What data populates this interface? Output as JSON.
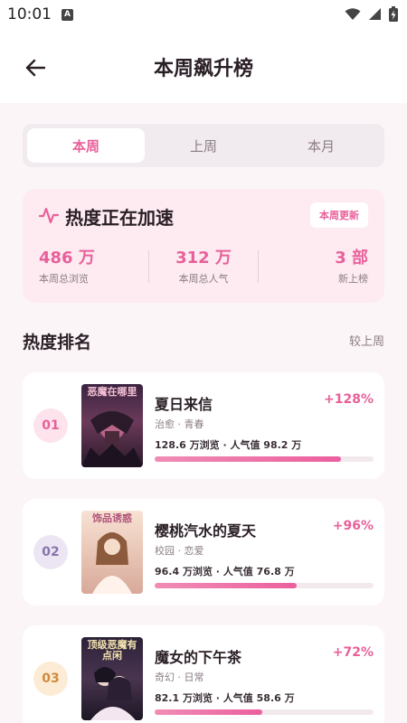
{
  "status_bar": {
    "time": "10:01",
    "notification_icon": "A",
    "icons": [
      "wifi-icon",
      "cellular-signal-icon",
      "battery-charging-icon"
    ]
  },
  "header": {
    "back_icon": "arrow-left-icon",
    "title": "本周飙升榜"
  },
  "tabs": [
    {
      "label": "本周",
      "active": true
    },
    {
      "label": "上周",
      "active": false
    },
    {
      "label": "本月",
      "active": false
    }
  ],
  "heat_card": {
    "icon": "pulse-icon",
    "title": "热度正在加速",
    "badge": "本周更新",
    "stats": [
      {
        "value": "486 万",
        "label": "本周总浏览"
      },
      {
        "value": "312 万",
        "label": "本周总人气"
      },
      {
        "value": "3 部",
        "label": "新上榜"
      }
    ]
  },
  "ranking": {
    "title": "热度排名",
    "compare_label": "较上周",
    "items": [
      {
        "rank": "01",
        "title": "夏日来信",
        "growth": "+128%",
        "tags": "治愈 · 青春",
        "stats": "128.6 万浏览 · 人气值 98.2 万",
        "progress": 0.85,
        "cover_text": "恶魔在哪里",
        "rank_bg": "#fde3ec",
        "rank_color": "#e8609a"
      },
      {
        "rank": "02",
        "title": "樱桃汽水的夏天",
        "growth": "+96%",
        "tags": "校园 · 恋爱",
        "stats": "96.4 万浏览 · 人气值 76.8 万",
        "progress": 0.65,
        "cover_text": "饰品诱惑",
        "rank_bg": "#ece6f4",
        "rank_color": "#8a74ad"
      },
      {
        "rank": "03",
        "title": "魔女的下午茶",
        "growth": "+72%",
        "tags": "奇幻 · 日常",
        "stats": "82.1 万浏览 · 人气值 58.6 万",
        "progress": 0.49,
        "cover_text": "顶级恶魔有点闲",
        "rank_bg": "#fcecd5",
        "rank_color": "#d08a3c"
      }
    ]
  }
}
